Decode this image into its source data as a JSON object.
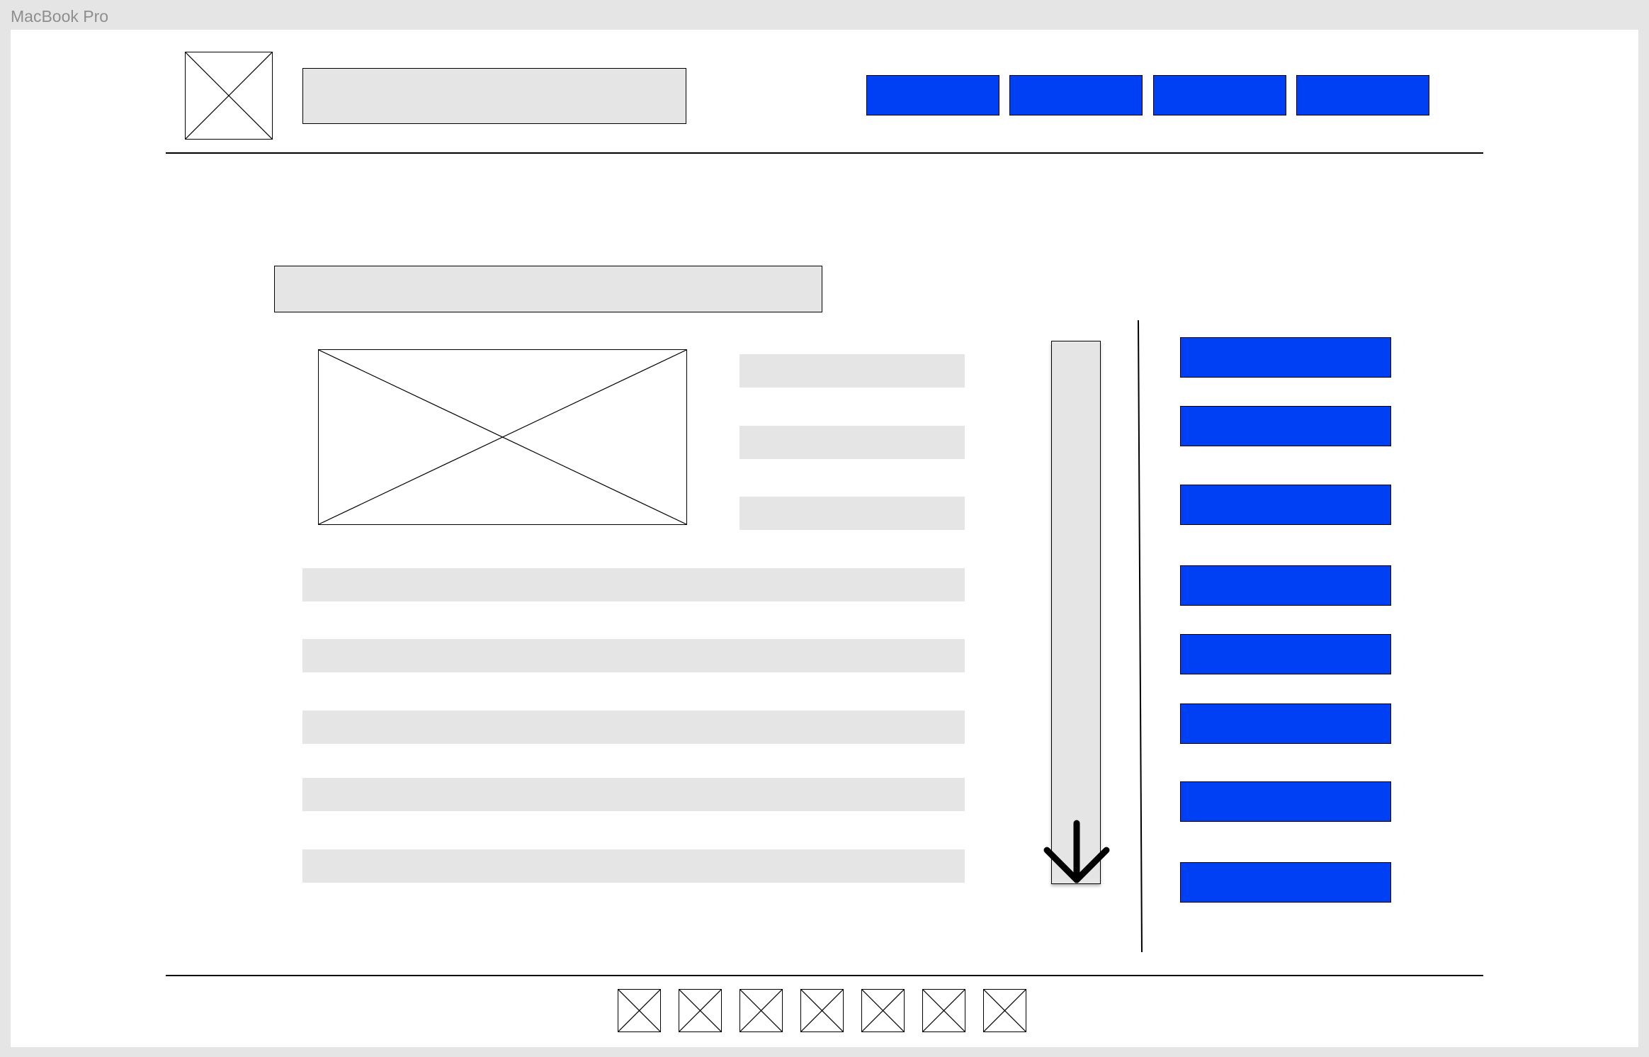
{
  "frame": {
    "label": "MacBook Pro"
  },
  "colors": {
    "accent": "#0040f5",
    "placeholder_fill": "#e5e5e5",
    "stroke": "#000000",
    "frame_label": "#8e8e8e"
  },
  "header": {
    "logo_icon": "image-placeholder-icon",
    "nav_buttons_count": 4
  },
  "main": {
    "image_icon": "image-placeholder-icon",
    "text_line_placeholders": 8
  },
  "scrollbar": {
    "icon": "arrow-down-icon"
  },
  "side_menu": {
    "buttons_count": 8
  },
  "footer": {
    "icon": "image-placeholder-icon",
    "icons_count": 7
  }
}
